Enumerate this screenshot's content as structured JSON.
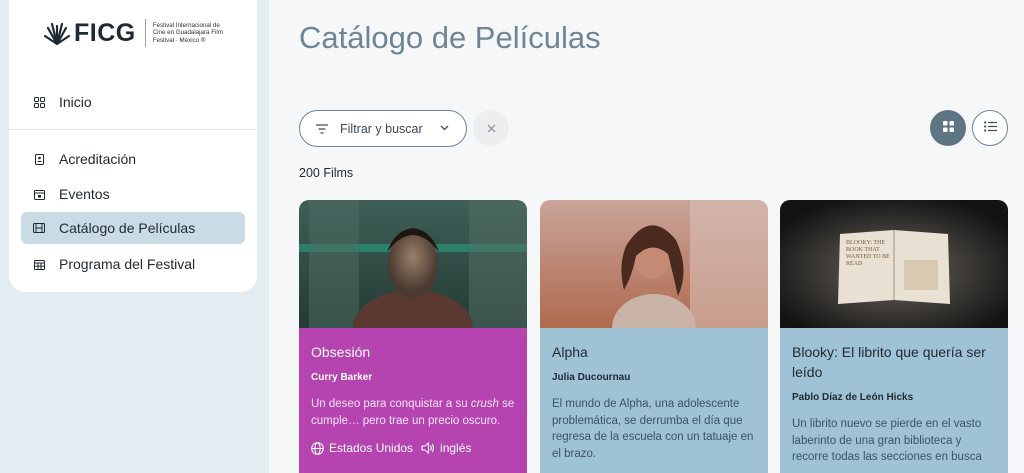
{
  "logo": {
    "text": "FICG",
    "subtitle": "Festival Internacional de Cine en Guadalajara Film Festival · México ®"
  },
  "sidebar": {
    "items": [
      {
        "label": "Inicio",
        "icon": "grid-icon"
      },
      {
        "label": "Acreditación",
        "icon": "badge-icon"
      },
      {
        "label": "Eventos",
        "icon": "calendar-icon"
      },
      {
        "label": "Catálogo de Películas",
        "icon": "film-icon",
        "active": true
      },
      {
        "label": "Programa del Festival",
        "icon": "calendar-grid-icon"
      }
    ]
  },
  "main": {
    "title": "Catálogo de Películas",
    "filter_label": "Filtrar y buscar",
    "count": "200 Films"
  },
  "films": [
    {
      "title": "Obsesión",
      "director": "Curry Barker",
      "synopsis_pre": "Un deseo para conquistar a su ",
      "synopsis_em": "crush",
      "synopsis_post": " se cumple… pero trae un precio oscuro.",
      "country": "Estados Unidos",
      "language": "inglés",
      "color": "#b543b0"
    },
    {
      "title": "Alpha",
      "director": "Julia Ducournau",
      "synopsis": "El mundo de Alpha, una adolescente problemática, se derrumba el día que regresa de la escuela con un tatuaje en el brazo.",
      "color": "#9fc2d4"
    },
    {
      "title": "Blooky: El librito que quería ser leído",
      "director": "Pablo Díaz de León Hicks",
      "synopsis": "Un librito nuevo se pierde en el vasto laberinto de una gran biblioteca y recorre todas las secciones en busca",
      "book_text": "BLOOKY: THE BOOK THAT WANTED TO BE READ",
      "color": "#9fc2d4"
    }
  ]
}
